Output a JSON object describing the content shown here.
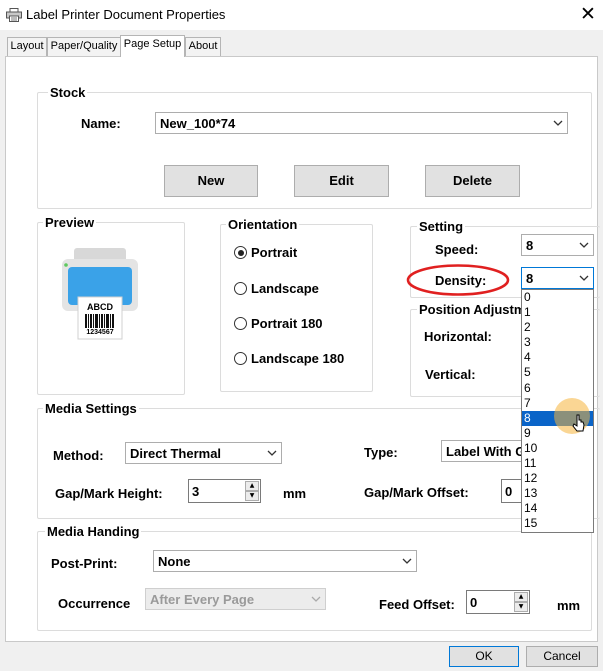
{
  "window": {
    "title": "Label Printer Document Properties"
  },
  "tabs": [
    {
      "label": "Layout"
    },
    {
      "label": "Paper/Quality"
    },
    {
      "label": "Page Setup"
    },
    {
      "label": "About"
    }
  ],
  "stock": {
    "group_label": "Stock",
    "name_label": "Name:",
    "name_value": "New_100*74",
    "buttons": {
      "new": "New",
      "edit": "Edit",
      "delete": "Delete"
    }
  },
  "preview": {
    "group_label": "Preview",
    "label_text": "ABCD",
    "barcode_number": "1234567"
  },
  "orientation": {
    "group_label": "Orientation",
    "options": [
      {
        "label": "Portrait",
        "selected": true
      },
      {
        "label": "Landscape",
        "selected": false
      },
      {
        "label": "Portrait 180",
        "selected": false
      },
      {
        "label": "Landscape 180",
        "selected": false
      }
    ]
  },
  "setting": {
    "group_label": "Setting",
    "speed_label": "Speed:",
    "speed_value": "8",
    "density_label": "Density:",
    "density_value": "8",
    "density_options": [
      "0",
      "1",
      "2",
      "3",
      "4",
      "5",
      "6",
      "7",
      "8",
      "9",
      "10",
      "11",
      "12",
      "13",
      "14",
      "15"
    ],
    "density_selected": "8",
    "highlight_color": "#e02020"
  },
  "position_adjust": {
    "group_label": "Position Adjustm",
    "horizontal_label": "Horizontal:",
    "vertical_label": "Vertical:"
  },
  "media_settings": {
    "group_label": "Media Settings",
    "method_label": "Method:",
    "method_value": "Direct Thermal",
    "type_label": "Type:",
    "type_value": "Label With G",
    "gap_height_label": "Gap/Mark Height:",
    "gap_height_value": "3",
    "gap_height_unit": "mm",
    "gap_offset_label": "Gap/Mark Offset:",
    "gap_offset_value": "0"
  },
  "media_handing": {
    "group_label": "Media Handing",
    "post_print_label": "Post-Print:",
    "post_print_value": "None",
    "occurrence_label": "Occurrence",
    "occurrence_value": "After Every Page",
    "feed_offset_label": "Feed Offset:",
    "feed_offset_value": "0",
    "feed_offset_unit": "mm"
  },
  "footer": {
    "ok": "OK",
    "cancel": "Cancel"
  }
}
